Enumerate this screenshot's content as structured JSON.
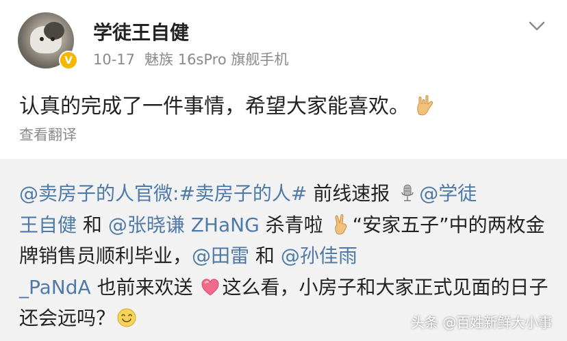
{
  "post": {
    "username": "学徒王自健",
    "date": "10-17",
    "device": "魅族 16sPro 旗舰手机",
    "body": "认真的完成了一件事情，希望大家能喜欢。",
    "translate_label": "查看翻译",
    "hand_emoji": "rock-hand-emoji",
    "verified_badge": "V",
    "badge_color": "#f5b700"
  },
  "repost": {
    "mention_official": "@卖房子的人官微",
    "hashtag": ":#卖房子的人#",
    "text1": " 前线速报 ",
    "mention_wang_1": "@学徒",
    "mention_wang_2": "王自健",
    "and1": " 和 ",
    "mention_zhang": "@张晓谦 ZHaNG",
    "text2": " 杀青啦 ",
    "text3": "“安家五子”中的两枚金牌销售员顺利毕业，",
    "mention_tian": "@田雷",
    "and2": " 和 ",
    "mention_sun_1": "@孙佳雨",
    "mention_sun_2": "_PaNdA",
    "text4": " 也前来欢送 ",
    "text5": "这么看，小房子和大家正式见面的日子还会远吗？",
    "link_color": "#4d7aa8"
  },
  "watermark": "头条 @百姓新鲜大小事"
}
